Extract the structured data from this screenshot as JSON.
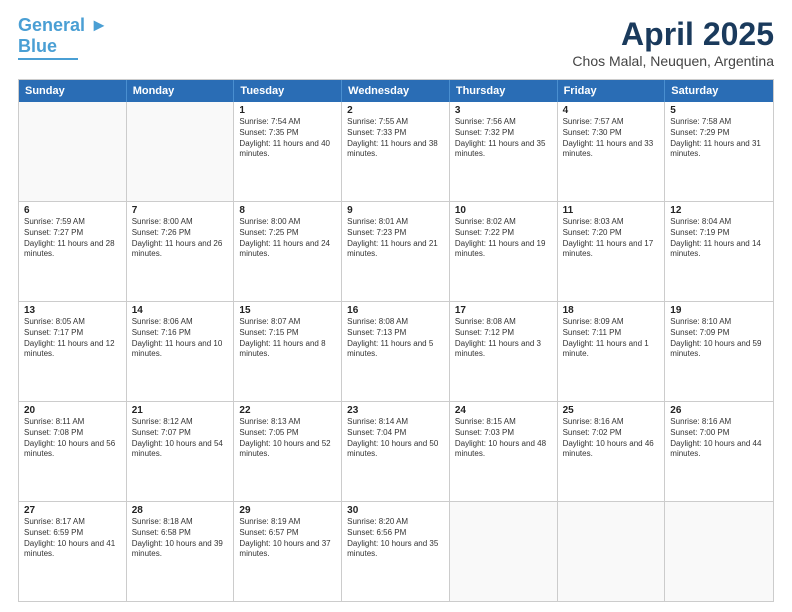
{
  "logo": {
    "line1": "General",
    "line2": "Blue"
  },
  "title": "April 2025",
  "subtitle": "Chos Malal, Neuquen, Argentina",
  "weekdays": [
    "Sunday",
    "Monday",
    "Tuesday",
    "Wednesday",
    "Thursday",
    "Friday",
    "Saturday"
  ],
  "rows": [
    [
      {
        "day": "",
        "text": ""
      },
      {
        "day": "",
        "text": ""
      },
      {
        "day": "1",
        "text": "Sunrise: 7:54 AM\nSunset: 7:35 PM\nDaylight: 11 hours and 40 minutes."
      },
      {
        "day": "2",
        "text": "Sunrise: 7:55 AM\nSunset: 7:33 PM\nDaylight: 11 hours and 38 minutes."
      },
      {
        "day": "3",
        "text": "Sunrise: 7:56 AM\nSunset: 7:32 PM\nDaylight: 11 hours and 35 minutes."
      },
      {
        "day": "4",
        "text": "Sunrise: 7:57 AM\nSunset: 7:30 PM\nDaylight: 11 hours and 33 minutes."
      },
      {
        "day": "5",
        "text": "Sunrise: 7:58 AM\nSunset: 7:29 PM\nDaylight: 11 hours and 31 minutes."
      }
    ],
    [
      {
        "day": "6",
        "text": "Sunrise: 7:59 AM\nSunset: 7:27 PM\nDaylight: 11 hours and 28 minutes."
      },
      {
        "day": "7",
        "text": "Sunrise: 8:00 AM\nSunset: 7:26 PM\nDaylight: 11 hours and 26 minutes."
      },
      {
        "day": "8",
        "text": "Sunrise: 8:00 AM\nSunset: 7:25 PM\nDaylight: 11 hours and 24 minutes."
      },
      {
        "day": "9",
        "text": "Sunrise: 8:01 AM\nSunset: 7:23 PM\nDaylight: 11 hours and 21 minutes."
      },
      {
        "day": "10",
        "text": "Sunrise: 8:02 AM\nSunset: 7:22 PM\nDaylight: 11 hours and 19 minutes."
      },
      {
        "day": "11",
        "text": "Sunrise: 8:03 AM\nSunset: 7:20 PM\nDaylight: 11 hours and 17 minutes."
      },
      {
        "day": "12",
        "text": "Sunrise: 8:04 AM\nSunset: 7:19 PM\nDaylight: 11 hours and 14 minutes."
      }
    ],
    [
      {
        "day": "13",
        "text": "Sunrise: 8:05 AM\nSunset: 7:17 PM\nDaylight: 11 hours and 12 minutes."
      },
      {
        "day": "14",
        "text": "Sunrise: 8:06 AM\nSunset: 7:16 PM\nDaylight: 11 hours and 10 minutes."
      },
      {
        "day": "15",
        "text": "Sunrise: 8:07 AM\nSunset: 7:15 PM\nDaylight: 11 hours and 8 minutes."
      },
      {
        "day": "16",
        "text": "Sunrise: 8:08 AM\nSunset: 7:13 PM\nDaylight: 11 hours and 5 minutes."
      },
      {
        "day": "17",
        "text": "Sunrise: 8:08 AM\nSunset: 7:12 PM\nDaylight: 11 hours and 3 minutes."
      },
      {
        "day": "18",
        "text": "Sunrise: 8:09 AM\nSunset: 7:11 PM\nDaylight: 11 hours and 1 minute."
      },
      {
        "day": "19",
        "text": "Sunrise: 8:10 AM\nSunset: 7:09 PM\nDaylight: 10 hours and 59 minutes."
      }
    ],
    [
      {
        "day": "20",
        "text": "Sunrise: 8:11 AM\nSunset: 7:08 PM\nDaylight: 10 hours and 56 minutes."
      },
      {
        "day": "21",
        "text": "Sunrise: 8:12 AM\nSunset: 7:07 PM\nDaylight: 10 hours and 54 minutes."
      },
      {
        "day": "22",
        "text": "Sunrise: 8:13 AM\nSunset: 7:05 PM\nDaylight: 10 hours and 52 minutes."
      },
      {
        "day": "23",
        "text": "Sunrise: 8:14 AM\nSunset: 7:04 PM\nDaylight: 10 hours and 50 minutes."
      },
      {
        "day": "24",
        "text": "Sunrise: 8:15 AM\nSunset: 7:03 PM\nDaylight: 10 hours and 48 minutes."
      },
      {
        "day": "25",
        "text": "Sunrise: 8:16 AM\nSunset: 7:02 PM\nDaylight: 10 hours and 46 minutes."
      },
      {
        "day": "26",
        "text": "Sunrise: 8:16 AM\nSunset: 7:00 PM\nDaylight: 10 hours and 44 minutes."
      }
    ],
    [
      {
        "day": "27",
        "text": "Sunrise: 8:17 AM\nSunset: 6:59 PM\nDaylight: 10 hours and 41 minutes."
      },
      {
        "day": "28",
        "text": "Sunrise: 8:18 AM\nSunset: 6:58 PM\nDaylight: 10 hours and 39 minutes."
      },
      {
        "day": "29",
        "text": "Sunrise: 8:19 AM\nSunset: 6:57 PM\nDaylight: 10 hours and 37 minutes."
      },
      {
        "day": "30",
        "text": "Sunrise: 8:20 AM\nSunset: 6:56 PM\nDaylight: 10 hours and 35 minutes."
      },
      {
        "day": "",
        "text": ""
      },
      {
        "day": "",
        "text": ""
      },
      {
        "day": "",
        "text": ""
      }
    ]
  ]
}
